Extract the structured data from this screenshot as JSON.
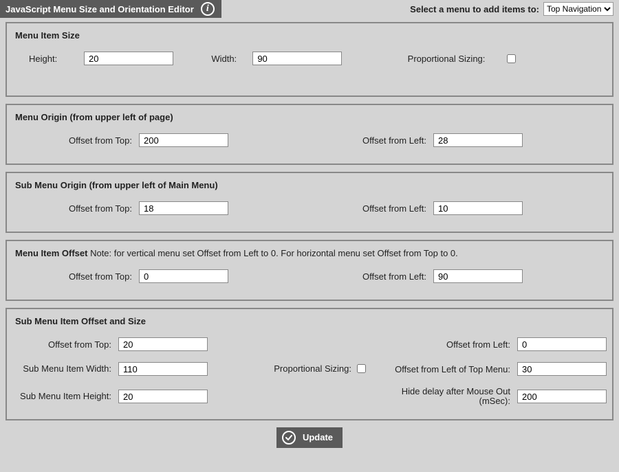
{
  "titlebar": {
    "title": "JavaScript Menu Size and Orientation Editor",
    "select_label": "Select a menu to add items to:",
    "select_value": "Top Navigation"
  },
  "size": {
    "title": "Menu Item Size",
    "height_label": "Height:",
    "height_value": "20",
    "width_label": "Width:",
    "width_value": "90",
    "prop_label": "Proportional Sizing:"
  },
  "origin": {
    "title": "Menu Origin (from upper left of page)",
    "top_label": "Offset from Top:",
    "top_value": "200",
    "left_label": "Offset from Left:",
    "left_value": "28"
  },
  "suborigin": {
    "title": "Sub Menu Origin (from upper left of Main Menu)",
    "top_label": "Offset from Top:",
    "top_value": "18",
    "left_label": "Offset from Left:",
    "left_value": "10"
  },
  "itemoffset": {
    "title_prefix": "Menu Item Offset",
    "note": " Note: for vertical menu set Offset from Left to 0. For horizontal menu set Offset from Top to 0.",
    "top_label": "Offset from Top:",
    "top_value": "0",
    "left_label": "Offset from Left:",
    "left_value": "90"
  },
  "sub": {
    "title": "Sub Menu Item Offset and Size",
    "top_label": "Offset from Top:",
    "top_value": "20",
    "left_label": "Offset from Left:",
    "left_value": "0",
    "width_label": "Sub Menu Item Width:",
    "width_value": "110",
    "prop_label": "Proportional Sizing:",
    "left2_label": "Offset from Left of Top Menu:",
    "left2_value": "30",
    "height_label": "Sub Menu Item Height:",
    "height_value": "20",
    "delay_label": "Hide delay after Mouse Out (mSec):",
    "delay_value": "200"
  },
  "update": "Update"
}
